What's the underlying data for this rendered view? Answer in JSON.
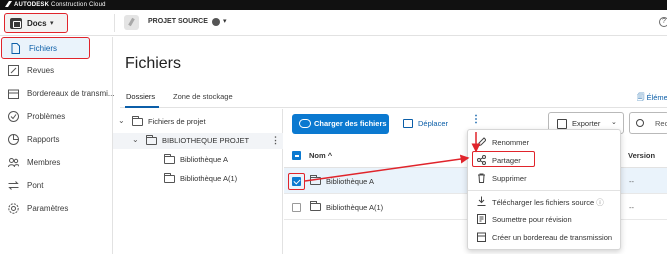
{
  "topbar": {
    "brand_bold": "AUTODESK",
    "brand_rest": " Construction Cloud"
  },
  "header": {
    "app_switcher_label": "Docs",
    "project_name": "PROJET SOURCE",
    "help": "?"
  },
  "sidebar": {
    "items": [
      {
        "label": "Fichiers",
        "icon": "file-icon",
        "active": true
      },
      {
        "label": "Revues",
        "icon": "review-icon"
      },
      {
        "label": "Bordereaux de transmi...",
        "icon": "transmittal-icon"
      },
      {
        "label": "Problèmes",
        "icon": "issue-icon"
      },
      {
        "label": "Rapports",
        "icon": "report-icon"
      },
      {
        "label": "Membres",
        "icon": "members-icon"
      },
      {
        "label": "Pont",
        "icon": "bridge-icon"
      },
      {
        "label": "Paramètres",
        "icon": "settings-icon"
      }
    ]
  },
  "main": {
    "title": "Fichiers",
    "tabs": [
      {
        "label": "Dossiers",
        "active": true
      },
      {
        "label": "Zone de stockage"
      }
    ],
    "tab_right": "Élémen"
  },
  "tree": {
    "root": "Fichiers de projet",
    "project_folder": "BIBLIOTHEQUE PROJET",
    "children": [
      "Bibliothèque A",
      "Bibliothèque A(1)"
    ]
  },
  "toolbar": {
    "upload_label": "Charger des fichiers",
    "move_label": "Déplacer",
    "more_label": "⋮",
    "export_label": "Exporter",
    "search_label": "Rec"
  },
  "table": {
    "headers": {
      "name": "Nom ^",
      "version": "Version"
    },
    "rows": [
      {
        "name": "Bibliothèque A",
        "version": "--",
        "checked": true
      },
      {
        "name": "Bibliothèque A(1)",
        "version": "--",
        "checked": false
      }
    ]
  },
  "context_menu": {
    "items": [
      {
        "label": "Renommer",
        "icon": "pencil-icon"
      },
      {
        "label": "Partager",
        "icon": "share-icon"
      },
      {
        "label": "Supprimer",
        "icon": "trash-icon"
      },
      {
        "label": "Télécharger les fichiers source",
        "icon": "download-icon",
        "info": "ⓘ"
      },
      {
        "label": "Soumettre pour révision",
        "icon": "submit-review-icon"
      },
      {
        "label": "Créer un bordereau de transmission",
        "icon": "transmittal-create-icon"
      }
    ]
  },
  "colors": {
    "accent": "#0b79d0",
    "highlight": "#e0242b",
    "selection": "#eaf3fb"
  }
}
